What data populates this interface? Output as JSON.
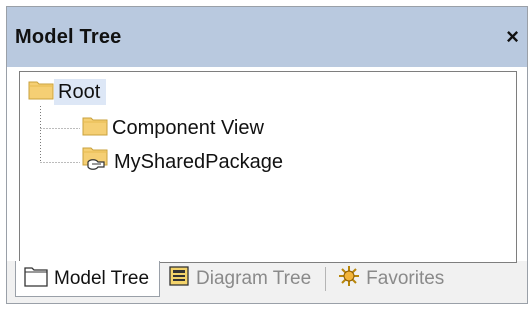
{
  "panel": {
    "title": "Model Tree",
    "close_glyph": "×"
  },
  "tree": {
    "root": {
      "label": "Root",
      "icon": "folder-icon",
      "selected": true
    },
    "children": [
      {
        "label": "Component View",
        "icon": "folder-icon"
      },
      {
        "label": "MySharedPackage",
        "icon": "shared-package-icon"
      }
    ]
  },
  "tabs": [
    {
      "label": "Model Tree",
      "icon": "model-tree-tab-icon",
      "active": true
    },
    {
      "label": "Diagram Tree",
      "icon": "diagram-tree-tab-icon",
      "active": false
    },
    {
      "label": "Favorites",
      "icon": "favorites-tab-icon",
      "active": false
    }
  ],
  "colors": {
    "titlebar": "#b9c9df",
    "selection": "#dde7f6",
    "folder": "#f5cf74",
    "inactive_text": "#8a8a8a"
  }
}
